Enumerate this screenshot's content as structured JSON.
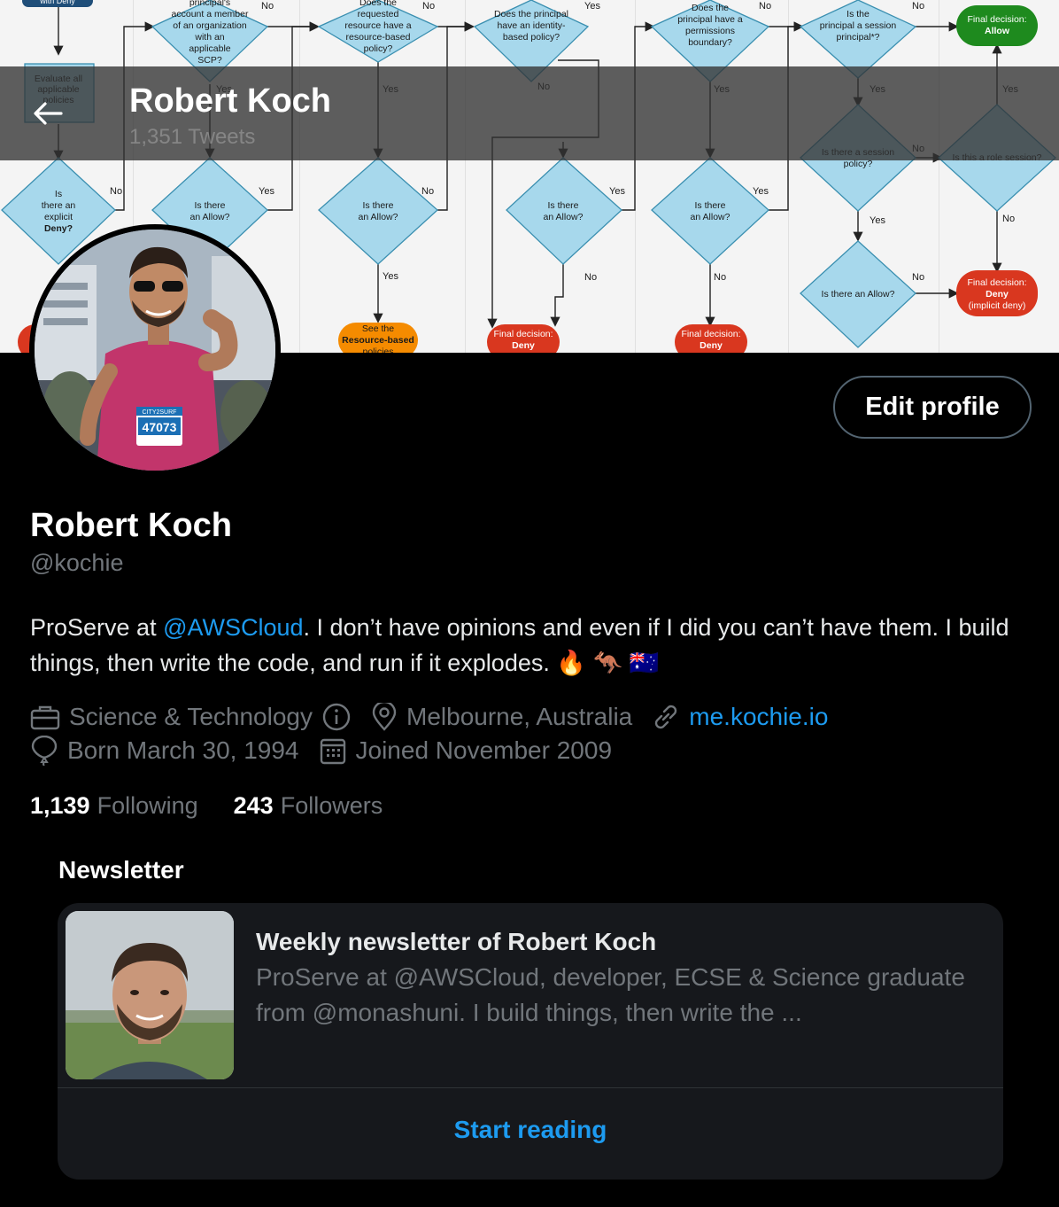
{
  "header": {
    "name": "Robert Koch",
    "tweet_count": "1,351 Tweets"
  },
  "banner": {
    "nodes": {
      "evaluate": "Evaluate all applicable policies",
      "explicit_deny": "Is there an explicit Deny?",
      "org_member": "principal's account a member of an organization with an applicable SCP?",
      "allow1": "Is there an Allow?",
      "resource_policy": "Does the requested resource have a resource-based policy?",
      "allow2": "Is there an Allow?",
      "identity_policy": "Does the principal have an identity-based policy?",
      "allow3": "Is there an Allow?",
      "perm_boundary": "Does the principal have a permissions boundary?",
      "allow4": "Is there an Allow?",
      "session_principal": "Is the principal a session principal*?",
      "session_policy": "Is there a session policy?",
      "role_session": "Is this a role session?",
      "allow5": "Is there an Allow?",
      "final_allow": "Final decision: Allow",
      "final_deny": "Final decision: Deny",
      "final_implicit": "Final decision: Deny (implicit deny)",
      "see_resource": "See the Resource-based policies",
      "with_deny": "with Deny"
    },
    "yes": "Yes",
    "no": "No"
  },
  "profile": {
    "edit_label": "Edit profile",
    "name": "Robert Koch",
    "handle": "@kochie",
    "bio_before": "ProServe at ",
    "bio_mention": "@AWSCloud",
    "bio_after": ". I don’t have opinions and even if I did you can’t have them. I build things, then write the code, and run if it explodes. 🔥 🦘 🇦🇺",
    "category": "Science & Technology",
    "location": "Melbourne, Australia",
    "website": "me.kochie.io",
    "birthday": "Born March 30, 1994",
    "joined": "Joined November 2009",
    "following_count": "1,139",
    "following_label": "Following",
    "followers_count": "243",
    "followers_label": "Followers"
  },
  "avatar": {
    "bib_brand": "CITY2SURF",
    "bib_number": "47073"
  },
  "newsletter": {
    "section_title": "Newsletter",
    "headline": "Weekly newsletter of Robert Koch",
    "description": "ProServe at @AWSCloud, developer, ECSE & Science graduate from @monashuni. I build things, then write the ...",
    "cta": "Start reading"
  },
  "colors": {
    "accent": "#1d9bf0",
    "muted": "#71767b",
    "diamond": "#a7d8ec",
    "allow": "#1e8a1e",
    "deny": "#d9371f",
    "orange": "#f58b00"
  }
}
